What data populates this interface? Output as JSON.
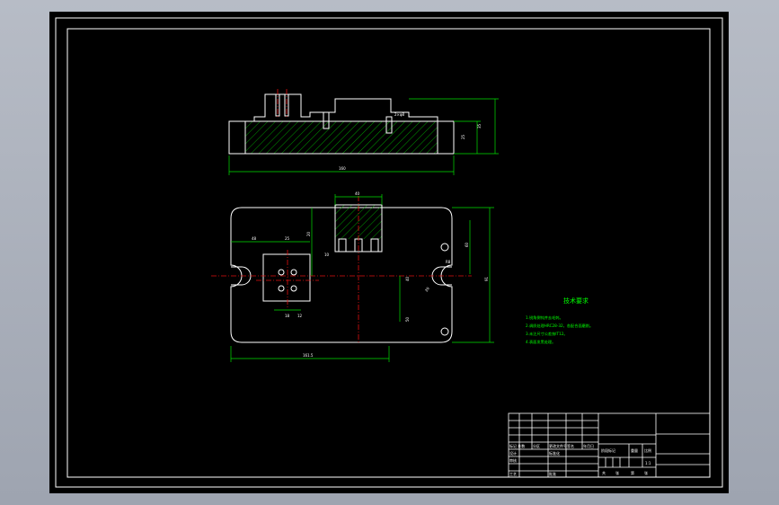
{
  "drawing": {
    "top_view_dims": {
      "overall_width": "160",
      "height_a": "25",
      "height_b": "35",
      "hole": "2×φ8"
    },
    "plan_view_dims": {
      "block_width": "40",
      "left_offset": "48",
      "left_sub": "25",
      "overall_height": "91",
      "right_height": "60",
      "vertical_a": "20",
      "vertical_b": "50",
      "vertical_c": "40",
      "hole_spacing": "18",
      "hole_spacing_b": "12",
      "slot_radius": "R8",
      "angle_dim": "20",
      "bottom_width": "161.5",
      "small_dim": "10"
    },
    "notes": {
      "title": "技术要求",
      "lines": [
        "1.锐角倒钝并去毛刺。",
        "2.调质处理HRC28-32，各配合面磨削。",
        "3.未注尺寸公差按IT12。",
        "4.表面发黑处理。"
      ]
    },
    "title_block": {
      "rows_left": [
        "标记 处数",
        "设计",
        "审核",
        "工艺"
      ],
      "col_labels": [
        "分区",
        "更改文件号",
        "签名",
        "年月日"
      ],
      "right_labels": [
        "阶段标记",
        "重量",
        "比例"
      ],
      "scale": "1:1",
      "sheet": [
        "共",
        "张",
        "第",
        "张"
      ],
      "approve": "批准",
      "standard": "标准化"
    }
  },
  "colors": {
    "background": "#000000",
    "outline": "#ffffff",
    "dimension": "#00e000",
    "centerline": "#e01010"
  }
}
